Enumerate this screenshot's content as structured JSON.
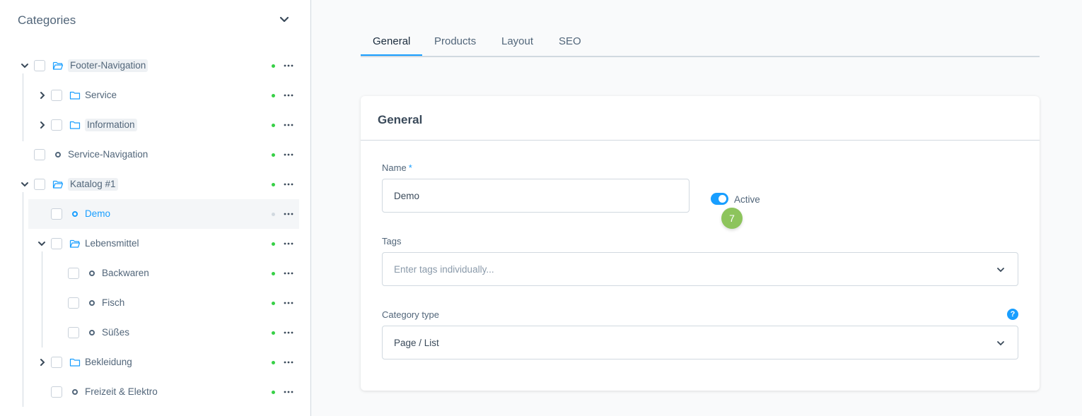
{
  "sidebar": {
    "title": "Categories",
    "items": [
      {
        "label": "Footer-Navigation"
      },
      {
        "label": "Service"
      },
      {
        "label": "Information"
      },
      {
        "label": "Service-Navigation"
      },
      {
        "label": "Katalog #1"
      },
      {
        "label": "Demo"
      },
      {
        "label": "Lebensmittel"
      },
      {
        "label": "Backwaren"
      },
      {
        "label": "Fisch"
      },
      {
        "label": "Süßes"
      },
      {
        "label": "Bekleidung"
      },
      {
        "label": "Freizeit & Elektro"
      }
    ]
  },
  "tabs": [
    {
      "label": "General"
    },
    {
      "label": "Products"
    },
    {
      "label": "Layout"
    },
    {
      "label": "SEO"
    }
  ],
  "card": {
    "title": "General",
    "name_label": "Name",
    "required_mark": "*",
    "name_value": "Demo",
    "active_label": "Active",
    "badge": "7",
    "tags_label": "Tags",
    "tags_placeholder": "Enter tags individually...",
    "category_type_label": "Category type",
    "category_type_value": "Page / List",
    "help_glyph": "?"
  },
  "colors": {
    "accent": "#189eff",
    "status_active": "#37d046",
    "badge": "#8dc45c"
  }
}
